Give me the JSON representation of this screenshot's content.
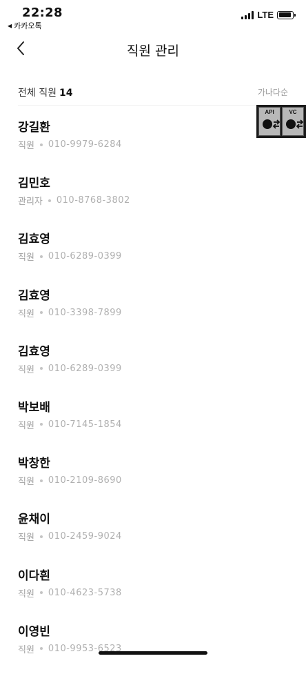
{
  "status_bar": {
    "time": "22:28",
    "back_app": "카카오톡",
    "network": "LTE"
  },
  "nav": {
    "title": "직원 관리"
  },
  "list_header": {
    "count_label": "전체 직원",
    "count_value": "14",
    "sort_label": "가나다순"
  },
  "overlay": {
    "api_label": "API",
    "vc_label": "VC"
  },
  "employees": [
    {
      "name": "강길환",
      "role": "직원",
      "phone": "010-9979-6284"
    },
    {
      "name": "김민호",
      "role": "관리자",
      "phone": "010-8768-3802"
    },
    {
      "name": "김효영",
      "role": "직원",
      "phone": "010-6289-0399"
    },
    {
      "name": "김효영",
      "role": "직원",
      "phone": "010-3398-7899"
    },
    {
      "name": "김효영",
      "role": "직원",
      "phone": "010-6289-0399"
    },
    {
      "name": "박보배",
      "role": "직원",
      "phone": "010-7145-1854"
    },
    {
      "name": "박창한",
      "role": "직원",
      "phone": "010-2109-8690"
    },
    {
      "name": "윤채이",
      "role": "직원",
      "phone": "010-2459-9024"
    },
    {
      "name": "이다흰",
      "role": "직원",
      "phone": "010-4623-5738"
    },
    {
      "name": "이영빈",
      "role": "직원",
      "phone": "010-9953-6523"
    }
  ]
}
